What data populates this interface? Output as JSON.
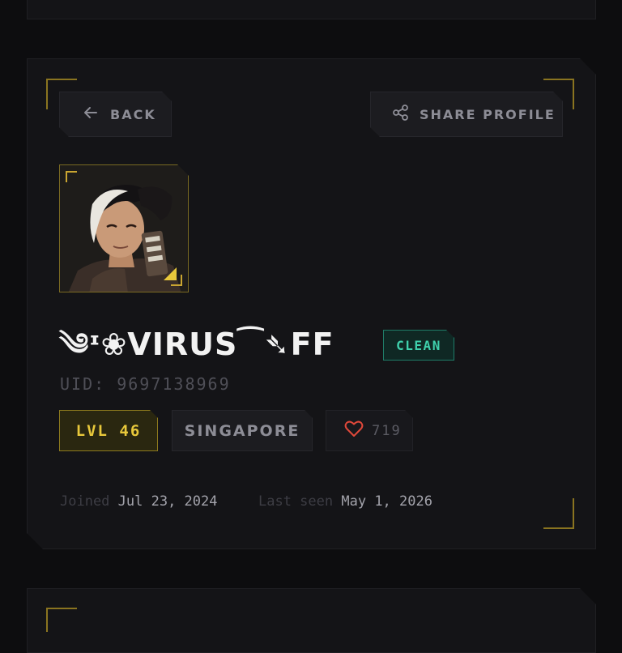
{
  "header": {
    "back_label": "BACK",
    "share_label": "SHARE PROFILE"
  },
  "profile": {
    "name": "༄ᶦ❀VIRUS⁀➴FF",
    "status_badge": "CLEAN",
    "uid_label": "UID:",
    "uid": "9697138969",
    "level": "LVL 46",
    "region": "SINGAPORE",
    "likes": "719",
    "joined_label": "Joined",
    "joined_date": "Jul 23, 2024",
    "last_seen_label": "Last seen",
    "last_seen_date": "May 1, 2026"
  },
  "icons": {
    "back": "arrow-left-icon",
    "share": "share-icon",
    "likes": "heart-icon"
  },
  "colors": {
    "accent_gold": "#e8c83b",
    "clean_green": "#3fd0ac",
    "heart_red": "#e0483a",
    "background": "#0d0d0f"
  }
}
